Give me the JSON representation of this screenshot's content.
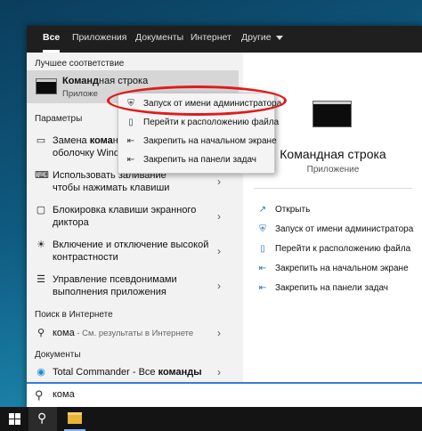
{
  "tabs": {
    "all": "Все",
    "apps": "Приложения",
    "documents": "Документы",
    "internet": "Интернет",
    "other": "Другие"
  },
  "best_match": {
    "header": "Лучшее соответствие",
    "title_bold": "Команд",
    "title_rest": "ная строка",
    "subtitle": "Приложе"
  },
  "context_menu": [
    "Запуск от имени администратора",
    "Перейти к расположению файла",
    "Закрепить на начальном экране",
    "Закрепить на панели задач"
  ],
  "settings": {
    "header": "Параметры",
    "items": [
      {
        "line1a": "Замена ",
        "line1b": "кома",
        "line1c": "нд",
        "line2": "оболочку Windo"
      },
      {
        "line1": "Использовать заливание",
        "line2": "чтобы нажимать клавиши"
      },
      {
        "line1": "Блокировка клавиши экранного",
        "line2": "диктора"
      },
      {
        "line1": "Включение и отключение высокой",
        "line2": "контрастности"
      },
      {
        "line1": "Управление псевдонимами",
        "line2": "выполнения приложения"
      }
    ]
  },
  "web": {
    "header": "Поиск в Интернете",
    "query": "кома",
    "hint": " - См. результаты в Интернете"
  },
  "docs": {
    "header": "Документы",
    "item_a": "Total Commander - Все ",
    "item_b": "команды"
  },
  "preview": {
    "title": "Командная строка",
    "subtitle": "Приложение"
  },
  "actions": [
    "Открыть",
    "Запуск от имени администратора",
    "Перейти к расположению файла",
    "Закрепить на начальном экране",
    "Закрепить на панели задач"
  ],
  "search": {
    "value": "кома"
  },
  "colors": {
    "highlight_oval": "#e01b1b",
    "accent": "#3a7bd5"
  }
}
